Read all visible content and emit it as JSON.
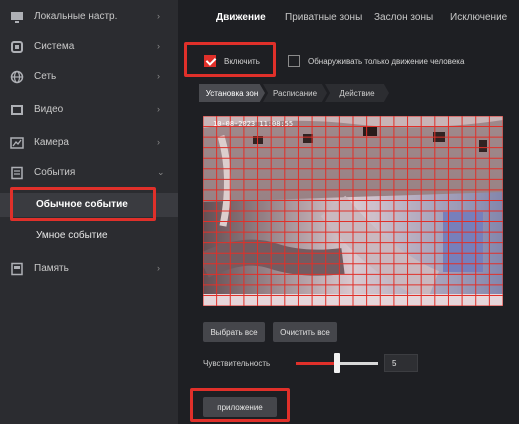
{
  "sidebar": {
    "items": [
      {
        "label": "Локальные настр.",
        "icon": "monitor-icon",
        "has_chevron": true
      },
      {
        "label": "Система",
        "icon": "system-icon",
        "has_chevron": true
      },
      {
        "label": "Сеть",
        "icon": "network-icon",
        "has_chevron": true
      },
      {
        "label": "Видео",
        "icon": "video-icon",
        "has_chevron": true
      },
      {
        "label": "Камера",
        "icon": "camera-icon",
        "has_chevron": true
      },
      {
        "label": "События",
        "icon": "events-icon",
        "has_chevron": true,
        "expanded": true
      },
      {
        "label": "Память",
        "icon": "storage-icon",
        "has_chevron": true
      }
    ],
    "events_sub": [
      {
        "label": "Обычное событие",
        "active": true
      },
      {
        "label": "Умное событие",
        "active": false
      }
    ],
    "chevron_right": "›",
    "chevron_down": "⌄"
  },
  "tabs": [
    {
      "label": "Движение",
      "active": true
    },
    {
      "label": "Приватные зоны",
      "active": false
    },
    {
      "label": "Заслон зоны",
      "active": false
    },
    {
      "label": "Исключение",
      "active": false
    }
  ],
  "enable_checkbox": {
    "label": "Включить",
    "checked": true
  },
  "human_checkbox": {
    "label": "Обнаруживать только движение человека",
    "checked": false
  },
  "subtabs": [
    {
      "label": "Установка зон",
      "active": true
    },
    {
      "label": "Расписание",
      "active": false
    },
    {
      "label": "Действие",
      "active": false
    }
  ],
  "video": {
    "timestamp": "10-08-2023 11:08:55"
  },
  "buttons": {
    "select_all": "Выбрать все",
    "clear_all": "Очистить все",
    "apply": "приложение"
  },
  "sensitivity": {
    "label": "Чувствительность",
    "value": "5",
    "min": 0,
    "max": 10,
    "fraction": 0.5
  },
  "colors": {
    "accent": "#e0302a",
    "sidebar_bg": "#2b2c30",
    "main_bg": "#1e1f23",
    "grid": "#e0302a"
  }
}
